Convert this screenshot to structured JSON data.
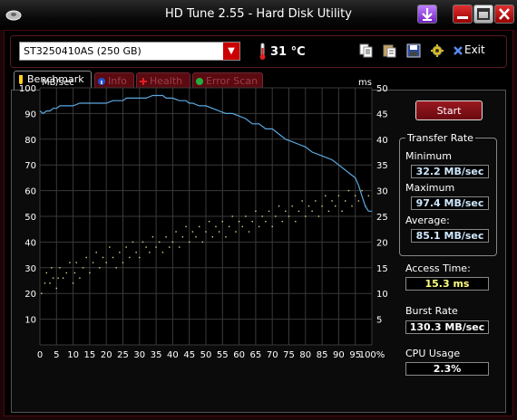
{
  "window": {
    "title": "HD Tune 2.55 - Hard Disk Utility",
    "controls": [
      "download-icon",
      "minimize-icon",
      "maximize-icon",
      "close-icon"
    ]
  },
  "toolbar": {
    "drive": "ST3250410AS (250 GB)",
    "temperature": "31 °C",
    "exit_label": "Exit"
  },
  "tabs": [
    {
      "label": "Benchmark",
      "active": true
    },
    {
      "label": "Info",
      "active": false
    },
    {
      "label": "Health",
      "active": false
    },
    {
      "label": "Error Scan",
      "active": false
    }
  ],
  "controls": {
    "start_label": "Start"
  },
  "results": {
    "transfer_rate_title": "Transfer Rate",
    "minimum_label": "Minimum",
    "minimum_value": "32.2 MB/sec",
    "maximum_label": "Maximum",
    "maximum_value": "97.4 MB/sec",
    "average_label": "Average:",
    "average_value": "85.1 MB/sec",
    "access_time_label": "Access Time:",
    "access_time_value": "15.3 ms",
    "burst_rate_label": "Burst Rate",
    "burst_rate_value": "130.3 MB/sec",
    "cpu_usage_label": "CPU Usage",
    "cpu_usage_value": "2.3%"
  },
  "colors": {
    "line": "#5aa8e0",
    "points": "#d8d890",
    "grid": "#3a3a3a",
    "accent": "#c0101a"
  },
  "chart_data": {
    "type": "line",
    "y_left_unit": "MB/sec",
    "y_right_unit": "ms",
    "x_ticks": [
      "0",
      "5",
      "10",
      "15",
      "20",
      "25",
      "30",
      "35",
      "40",
      "45",
      "50",
      "55",
      "60",
      "65",
      "70",
      "75",
      "80",
      "85",
      "90",
      "95",
      "100%"
    ],
    "y_left_ticks": [
      "100",
      "90",
      "80",
      "70",
      "60",
      "50",
      "40",
      "30",
      "20",
      "10"
    ],
    "y_right_ticks": [
      "50",
      "45",
      "40",
      "35",
      "30",
      "25",
      "20",
      "15",
      "10",
      "5"
    ],
    "xlim": [
      0,
      100
    ],
    "ylim_left": [
      0,
      100
    ],
    "ylim_right": [
      0,
      50
    ],
    "grid": true,
    "series": [
      {
        "kind": "transfer",
        "x": [
          0,
          1,
          2,
          3,
          4,
          5,
          6,
          7,
          8,
          10,
          12,
          14,
          16,
          18,
          20,
          22,
          23,
          24,
          25,
          26,
          27,
          28,
          30,
          32,
          34,
          35,
          36,
          37,
          38,
          40,
          42,
          44,
          45,
          46,
          48,
          50,
          52,
          54,
          56,
          58,
          60,
          62,
          64,
          66,
          68,
          70,
          72,
          74,
          76,
          78,
          80,
          82,
          84,
          86,
          88,
          90,
          92,
          94,
          95,
          96,
          97,
          98,
          99,
          100
        ],
        "y": [
          91,
          90,
          91,
          91,
          92,
          92,
          93,
          93,
          93,
          93,
          94,
          94,
          94,
          94,
          94,
          95,
          95,
          95,
          95,
          96,
          96,
          96,
          96,
          96,
          97,
          97,
          97,
          97,
          96,
          96,
          95,
          95,
          94,
          94,
          93,
          93,
          92,
          91,
          90,
          90,
          89,
          88,
          86,
          86,
          84,
          84,
          82,
          80,
          79,
          78,
          77,
          75,
          74,
          73,
          72,
          70,
          68,
          66,
          65,
          62,
          58,
          54,
          52,
          52
        ]
      },
      {
        "kind": "access_time_ms",
        "points": [
          [
            0.5,
            10
          ],
          [
            1.5,
            12
          ],
          [
            2,
            14
          ],
          [
            3,
            12
          ],
          [
            3.5,
            15
          ],
          [
            4,
            13
          ],
          [
            5,
            11
          ],
          [
            5.5,
            13
          ],
          [
            6,
            15
          ],
          [
            7,
            13
          ],
          [
            8,
            14
          ],
          [
            9,
            16
          ],
          [
            10,
            12
          ],
          [
            10.5,
            14
          ],
          [
            11,
            16
          ],
          [
            12,
            13
          ],
          [
            13,
            15
          ],
          [
            14,
            17
          ],
          [
            15,
            14
          ],
          [
            16,
            16
          ],
          [
            17,
            18
          ],
          [
            18,
            15
          ],
          [
            19,
            17
          ],
          [
            20,
            16
          ],
          [
            21,
            19
          ],
          [
            22,
            17
          ],
          [
            23,
            15
          ],
          [
            24,
            18
          ],
          [
            25,
            16
          ],
          [
            26,
            19
          ],
          [
            27,
            17
          ],
          [
            28,
            20
          ],
          [
            29,
            18
          ],
          [
            30,
            17
          ],
          [
            31,
            20
          ],
          [
            32,
            19
          ],
          [
            33,
            18
          ],
          [
            34,
            21
          ],
          [
            35,
            19
          ],
          [
            36,
            20
          ],
          [
            37,
            18
          ],
          [
            38,
            21
          ],
          [
            39,
            19
          ],
          [
            40,
            20
          ],
          [
            41,
            22
          ],
          [
            42,
            19
          ],
          [
            43,
            21
          ],
          [
            44,
            23
          ],
          [
            45,
            20
          ],
          [
            46,
            22
          ],
          [
            47,
            21
          ],
          [
            48,
            23
          ],
          [
            49,
            20
          ],
          [
            50,
            22
          ],
          [
            51,
            24
          ],
          [
            52,
            21
          ],
          [
            53,
            23
          ],
          [
            54,
            22
          ],
          [
            55,
            24
          ],
          [
            56,
            21
          ],
          [
            57,
            23
          ],
          [
            58,
            25
          ],
          [
            59,
            22
          ],
          [
            60,
            24
          ],
          [
            61,
            23
          ],
          [
            62,
            25
          ],
          [
            63,
            22
          ],
          [
            64,
            24
          ],
          [
            65,
            26
          ],
          [
            66,
            23
          ],
          [
            67,
            25
          ],
          [
            68,
            24
          ],
          [
            69,
            26
          ],
          [
            70,
            23
          ],
          [
            71,
            25
          ],
          [
            72,
            27
          ],
          [
            73,
            24
          ],
          [
            74,
            26
          ],
          [
            75,
            25
          ],
          [
            76,
            27
          ],
          [
            77,
            24
          ],
          [
            78,
            26
          ],
          [
            79,
            28
          ],
          [
            80,
            25
          ],
          [
            81,
            27
          ],
          [
            82,
            26
          ],
          [
            83,
            28
          ],
          [
            84,
            25
          ],
          [
            85,
            27
          ],
          [
            86,
            29
          ],
          [
            87,
            26
          ],
          [
            88,
            28
          ],
          [
            89,
            27
          ],
          [
            90,
            29
          ],
          [
            91,
            26
          ],
          [
            92,
            28
          ],
          [
            93,
            30
          ],
          [
            94,
            27
          ],
          [
            95,
            29
          ],
          [
            96,
            28
          ],
          [
            97,
            30
          ],
          [
            98,
            27
          ],
          [
            99,
            29
          ]
        ]
      }
    ]
  }
}
